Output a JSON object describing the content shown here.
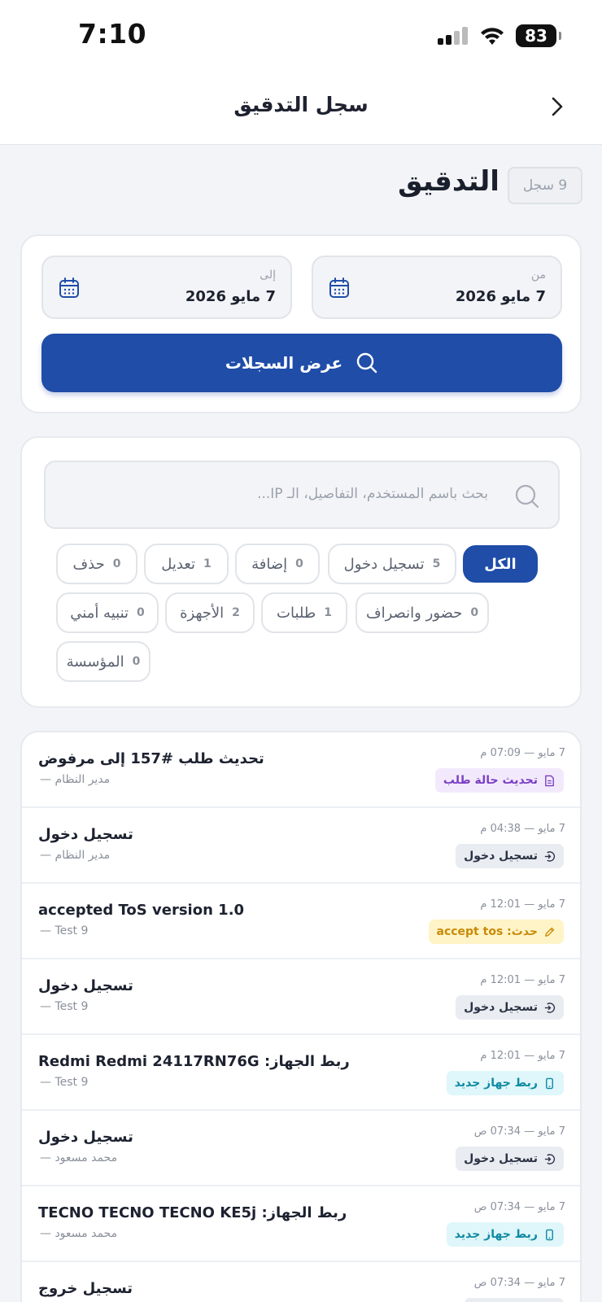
{
  "status_bar": {
    "time": "7:10",
    "battery": "83"
  },
  "nav": {
    "title": "سجل التدقيق"
  },
  "page": {
    "title": "سجل التدقيق",
    "count_badge": "9 سجل"
  },
  "date_filter": {
    "from_label": "من",
    "from_value": "7 مايو 2026",
    "to_label": "إلى",
    "to_value": "7 مايو 2026",
    "show_button": "عرض السجلات"
  },
  "search": {
    "placeholder": "بحث باسم المستخدم، التفاصيل، الـ IP..."
  },
  "filters": [
    {
      "label": "الكل",
      "count": ""
    },
    {
      "label": "تسجيل دخول",
      "count": "5"
    },
    {
      "label": "إضافة",
      "count": "0"
    },
    {
      "label": "تعديل",
      "count": "1"
    },
    {
      "label": "حذف",
      "count": "0"
    },
    {
      "label": "حضور وانصراف",
      "count": "0"
    },
    {
      "label": "طلبات",
      "count": "1"
    },
    {
      "label": "الأجهزة",
      "count": "2"
    },
    {
      "label": "تنبيه أمني",
      "count": "0"
    },
    {
      "label": "المؤسسة",
      "count": "0"
    }
  ],
  "logs": [
    {
      "title": "تحديث طلب #157 إلى مرفوض",
      "user": "مدير النظام —",
      "time": "7 مايو — 07:09 م",
      "tag": "تحديث حالة طلب",
      "tag_icon": "document-icon",
      "tag_color": "#7b3fc4",
      "tag_bg": "#f2eafc"
    },
    {
      "title": "تسجيل دخول",
      "user": "مدير النظام —",
      "time": "7 مايو — 04:38 م",
      "tag": "تسجيل دخول",
      "tag_icon": "login-icon",
      "tag_color": "#2b3345",
      "tag_bg": "#e9ecf1"
    },
    {
      "title": "accepted ToS version 1.0",
      "user": "— Test 9",
      "time": "7 مايو — 12:01 م",
      "tag": "حدث: accept tos",
      "tag_icon": "pencil-icon",
      "tag_color": "#c98a08",
      "tag_bg": "#fff4c7"
    },
    {
      "title": "تسجيل دخول",
      "user": "— Test 9",
      "time": "7 مايو — 12:01 م",
      "tag": "تسجيل دخول",
      "tag_icon": "login-icon",
      "tag_color": "#2b3345",
      "tag_bg": "#e9ecf1"
    },
    {
      "title": "ربط الجهاز: Redmi Redmi 24117RN76G",
      "user": "— Test 9",
      "time": "7 مايو — 12:01 م",
      "tag": "ربط جهاز جديد",
      "tag_icon": "phone-icon",
      "tag_color": "#0f8aa3",
      "tag_bg": "#dff6fa"
    },
    {
      "title": "تسجيل دخول",
      "user": "محمد مسعود —",
      "time": "7 مايو — 07:34 ص",
      "tag": "تسجيل دخول",
      "tag_icon": "login-icon",
      "tag_color": "#2b3345",
      "tag_bg": "#e9ecf1"
    },
    {
      "title": "ربط الجهاز: TECNO TECNO TECNO KE5j",
      "user": "محمد مسعود —",
      "time": "7 مايو — 07:34 ص",
      "tag": "ربط جهاز جديد",
      "tag_icon": "phone-icon",
      "tag_color": "#0f8aa3",
      "tag_bg": "#dff6fa"
    },
    {
      "title": "تسجيل خروج",
      "user": "",
      "time": "7 مايو — 07:34 ص",
      "tag": "",
      "tag_icon": "",
      "tag_color": "#2b3345",
      "tag_bg": "#e9ecf1"
    }
  ]
}
